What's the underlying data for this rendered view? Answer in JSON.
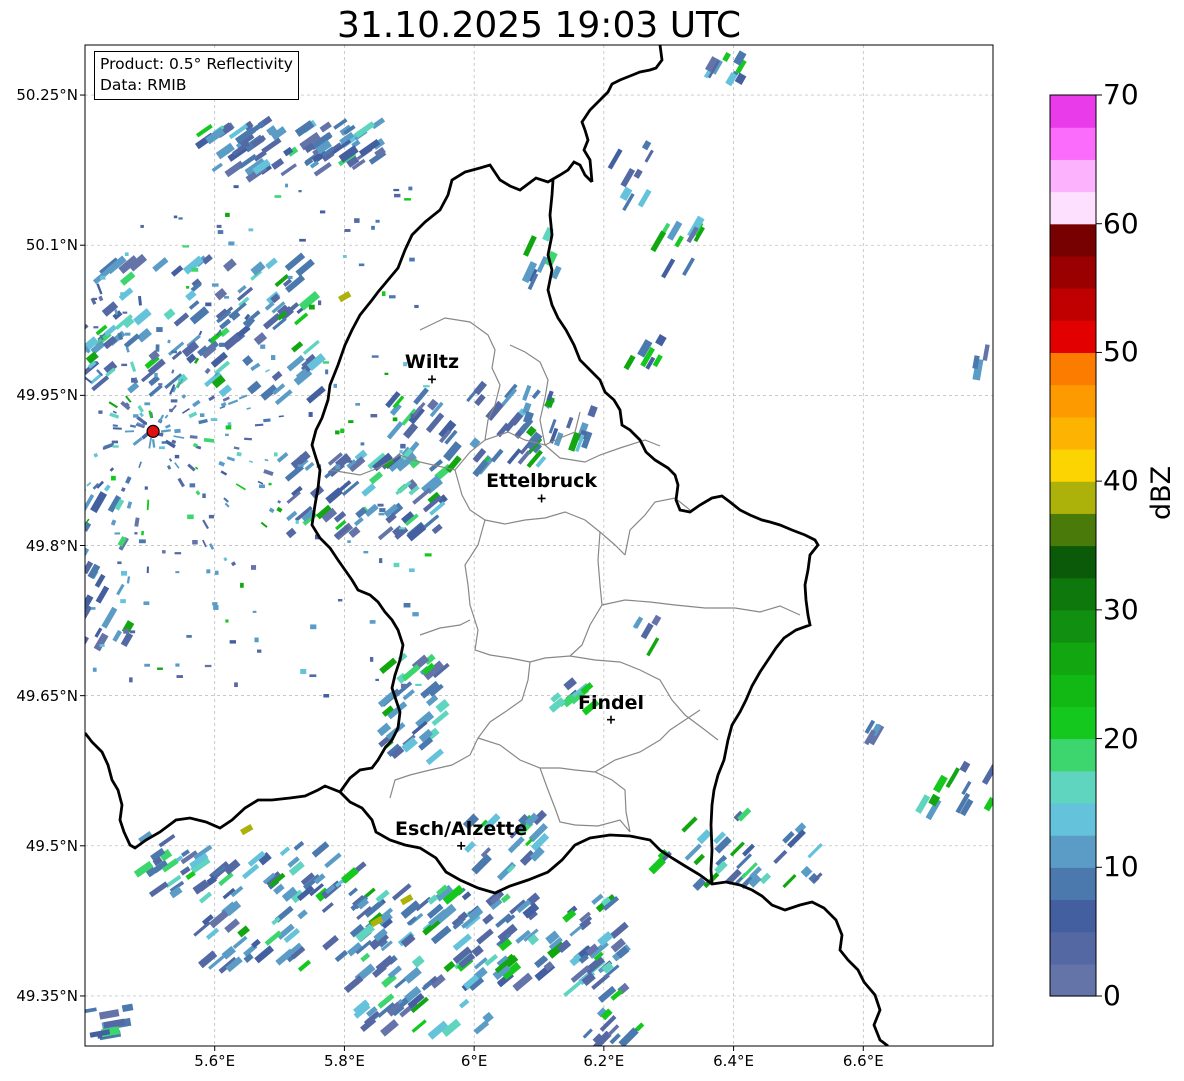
{
  "title": "31.10.2025 19:03 UTC",
  "info": {
    "product": "Product: 0.5° Reflectivity",
    "data": "Data: RMIB"
  },
  "lat_ticks": [
    "50.25°N",
    "50.1°N",
    "49.95°N",
    "49.8°N",
    "49.65°N",
    "49.5°N",
    "49.35°N"
  ],
  "lon_ticks": [
    "5.6°E",
    "5.8°E",
    "6°E",
    "6.2°E",
    "6.4°E",
    "6.6°E"
  ],
  "cities": [
    {
      "name": "Wiltz",
      "lon": 5.935,
      "lat": 49.966
    },
    {
      "name": "Ettelbruck",
      "lon": 6.104,
      "lat": 49.847
    },
    {
      "name": "Findel",
      "lon": 6.211,
      "lat": 49.626
    },
    {
      "name": "Esch/Alzette",
      "lon": 5.98,
      "lat": 49.5
    }
  ],
  "radar_site": {
    "lon": 5.505,
    "lat": 49.914
  },
  "colorbar": {
    "label": "dBZ",
    "ticks": [
      "0",
      "10",
      "20",
      "30",
      "40",
      "50",
      "60",
      "70"
    ],
    "range": [
      0,
      70
    ],
    "colors": [
      "#6473a8",
      "#5468a3",
      "#435f9f",
      "#4b79ad",
      "#5b9cc6",
      "#64c2db",
      "#5fd5c0",
      "#3dd66e",
      "#15c81d",
      "#12b814",
      "#12a711",
      "#118f10",
      "#0f780d",
      "#0a5a0a",
      "#4a7a0a",
      "#adb20a",
      "#fcd401",
      "#fcb301",
      "#fc9a00",
      "#fc7c00",
      "#e20000",
      "#c00000",
      "#9a0000",
      "#770000",
      "#fde0fe",
      "#fdb2fd",
      "#fb6cfc",
      "#e93bea"
    ]
  },
  "map_extent": {
    "lon": [
      5.4,
      6.8
    ],
    "lat": [
      49.3,
      50.3
    ]
  }
}
